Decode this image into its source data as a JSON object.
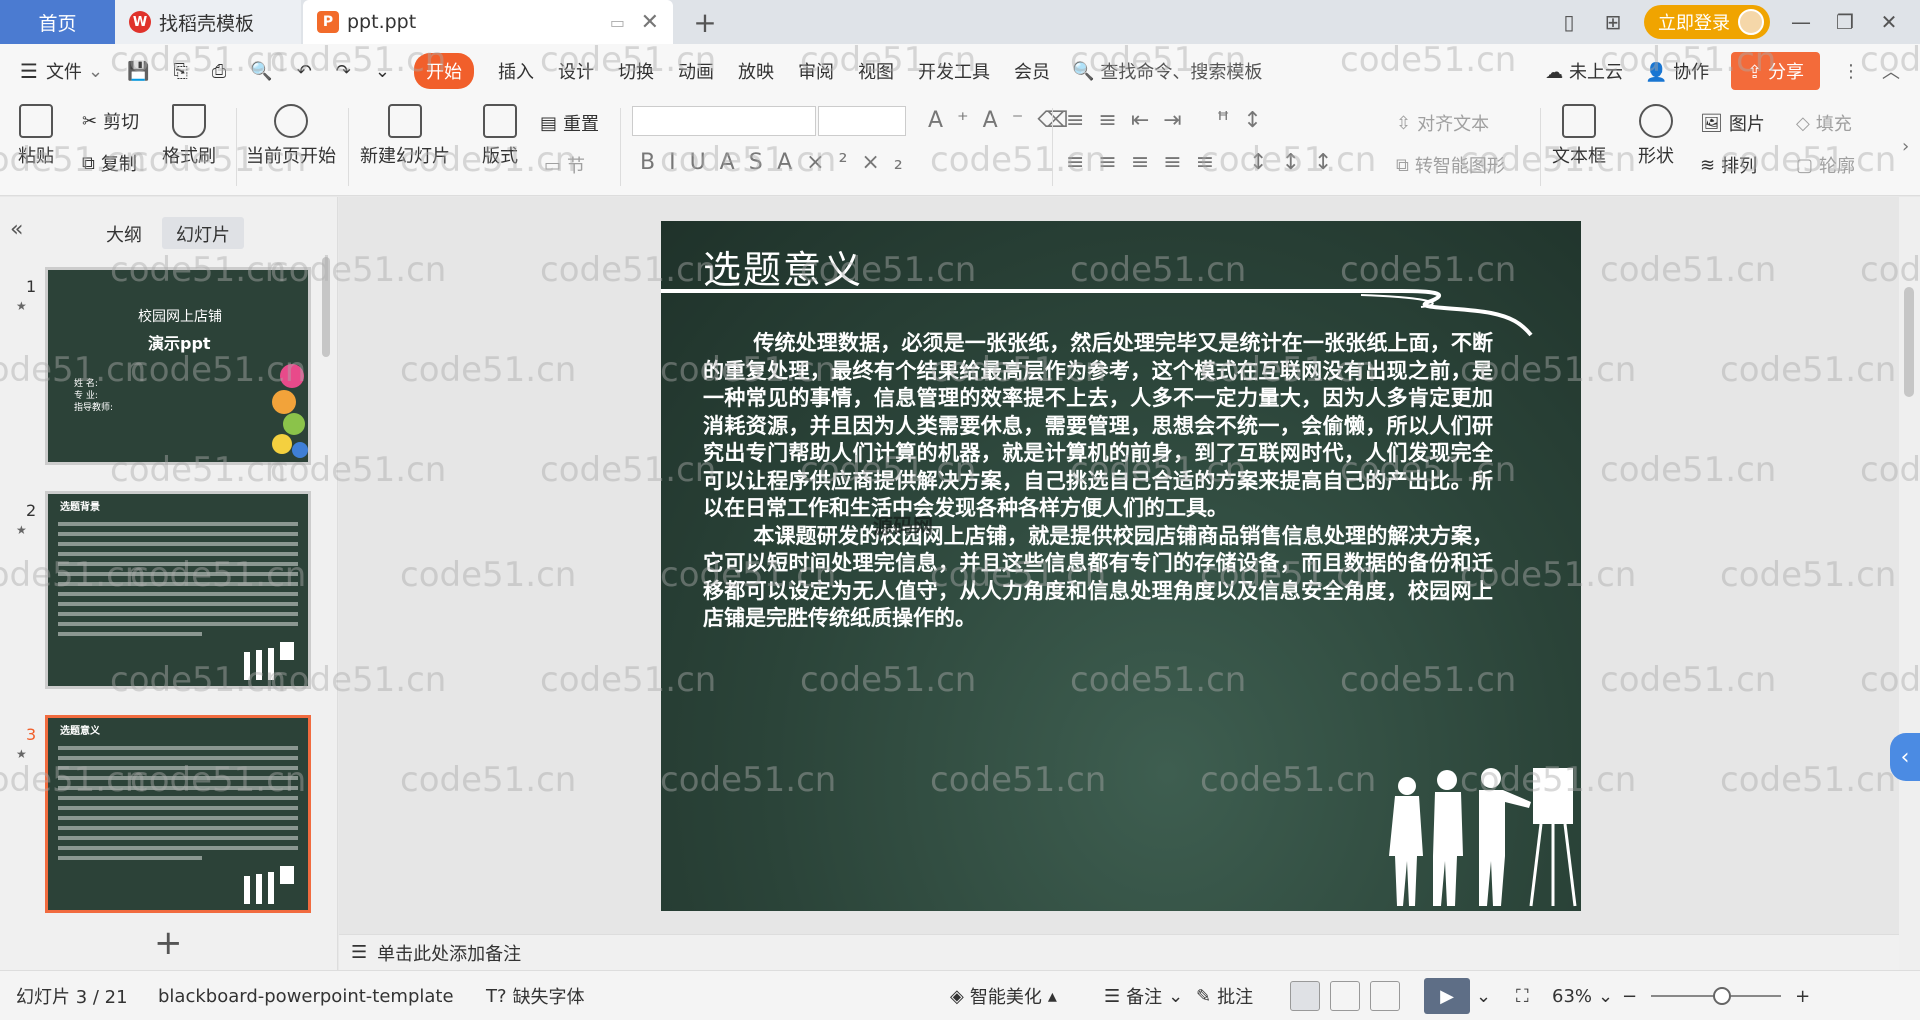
{
  "tabs": {
    "home": "首页",
    "find_template": "找稻壳模板",
    "active_file": "ppt.ppt"
  },
  "header_right": {
    "login_label": "立即登录"
  },
  "menu": {
    "file": "文件",
    "items": [
      "开始",
      "插入",
      "设计",
      "切换",
      "动画",
      "放映",
      "审阅",
      "视图",
      "开发工具",
      "会员"
    ],
    "search_placeholder": "查找命令、搜索模板",
    "cloud": "未上云",
    "collab": "协作",
    "share": "分享"
  },
  "ribbon": {
    "paste": "粘贴",
    "cut": "剪切",
    "copy": "复制",
    "format_painter": "格式刷",
    "play_from_current": "当前页开始",
    "new_slide": "新建幻灯片",
    "layout": "版式",
    "section": "节",
    "reset": "重置",
    "align_text": "对齐文本",
    "to_smartart": "转智能图形",
    "textbox": "文本框",
    "shape": "形状",
    "picture": "图片",
    "arrange": "排列",
    "fill": "填充",
    "outline": "轮廓"
  },
  "left_panel": {
    "tab_outline": "大纲",
    "tab_slides": "幻灯片",
    "thumbnails": [
      {
        "number": "1",
        "title_line1": "校园网上店铺",
        "title_line2": "演示ppt",
        "lbl1": "姓  名:",
        "lbl2": "专  业:",
        "lbl3": "指导教师:"
      },
      {
        "number": "2",
        "title": "选题背景"
      },
      {
        "number": "3",
        "title": "选题意义"
      }
    ]
  },
  "slide": {
    "title": "选题意义",
    "para1": "传统处理数据，必须是一张张纸，然后处理完毕又是统计在一张张纸上面，不断的重复处理，最终有个结果给最高层作为参考，这个模式在互联网没有出现之前，是一种常见的事情，信息管理的效率提不上去，人多不一定力量大，因为人多肯定更加消耗资源，并且因为人类需要休息，需要管理，思想会不统一，会偷懒，所以人们研究出专门帮助人们计算的机器，就是计算机的前身，到了互联网时代，人们发现完全可以让程序供应商提供解决方案，自己挑选自己合适的方案来提高自己的产出比。所以在日常工作和生活中会发现各种各样方便人们的工具。",
    "para2": "本课题研发的校园网上店铺，就是提供校园店铺商品销售信息处理的解决方案，它可以短时间处理完信息，并且这些信息都有专门的存储设备，而且数据的备份和迁移都可以设定为无人值守，从人力角度和信息处理角度以及信息安全角度，校园网上店铺是完胜传统纸质操作的。",
    "ghost_text": "源码网"
  },
  "notes_placeholder": "单击此处添加备注",
  "status": {
    "slide_counter": "幻灯片 3 / 21",
    "template_name": "blackboard-powerpoint-template",
    "missing_font": "缺失字体",
    "smart_beautify": "智能美化",
    "notes": "备注",
    "comments": "批注",
    "zoom": "63%"
  },
  "watermark": "code51.cn",
  "colors": {
    "accent": "#f15f2b",
    "home_tab": "#4b7bd1",
    "login": "#f0a400",
    "slide_bg": "#2b4439"
  }
}
